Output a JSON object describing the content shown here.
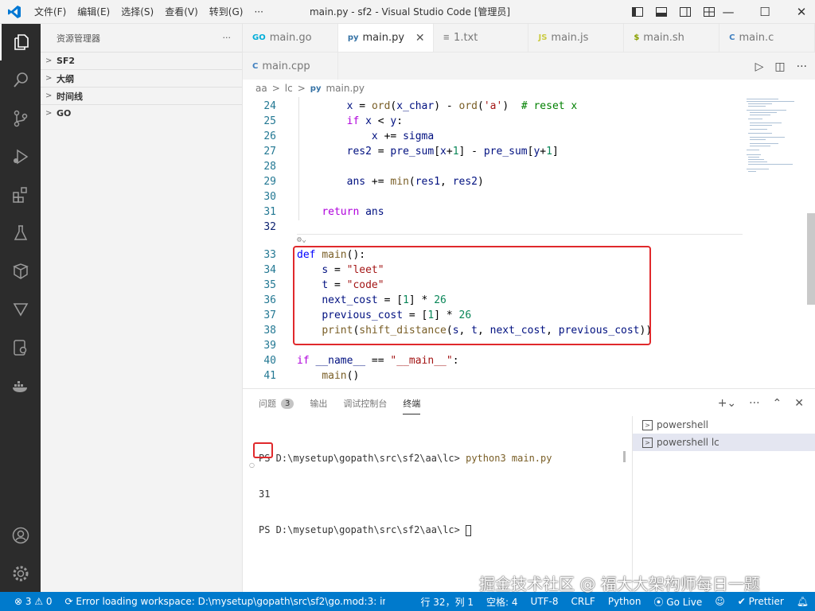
{
  "window": {
    "title": "main.py - sf2 - Visual Studio Code [管理员]",
    "menu": [
      "文件(F)",
      "编辑(E)",
      "选择(S)",
      "查看(V)",
      "转到(G)",
      "···"
    ],
    "controls": {
      "minimize": "—",
      "maximize": "☐",
      "close": "✕"
    }
  },
  "sidebar": {
    "title": "资源管理器",
    "more": "···",
    "sections": [
      "SF2",
      "大纲",
      "时间线",
      "GO"
    ]
  },
  "tabs": [
    {
      "label": "main.go",
      "icon": "GO"
    },
    {
      "label": "main.py",
      "icon": "py",
      "active": true
    },
    {
      "label": "1.txt",
      "icon": "≡"
    },
    {
      "label": "main.js",
      "icon": "JS"
    },
    {
      "label": "main.sh",
      "icon": "$"
    },
    {
      "label": "main.c",
      "icon": "C"
    },
    {
      "label": "main.cpp",
      "icon": "C"
    }
  ],
  "breadcrumb": [
    "aa",
    ">",
    "lc",
    ">",
    "main.py"
  ],
  "editor": {
    "lines": [
      {
        "n": "24",
        "code": "        x = ord(x_char) - ord('a')  # reset x"
      },
      {
        "n": "25",
        "code": "        if x < y:"
      },
      {
        "n": "26",
        "code": "            x += sigma"
      },
      {
        "n": "27",
        "code": "        res2 = pre_sum[x+1] - pre_sum[y+1]"
      },
      {
        "n": "28",
        "code": ""
      },
      {
        "n": "29",
        "code": "        ans += min(res1, res2)"
      },
      {
        "n": "30",
        "code": ""
      },
      {
        "n": "31",
        "code": "    return ans"
      },
      {
        "n": "32",
        "code": ""
      },
      {
        "n": "33",
        "code": "def main():"
      },
      {
        "n": "34",
        "code": "    s = \"leet\""
      },
      {
        "n": "35",
        "code": "    t = \"code\""
      },
      {
        "n": "36",
        "code": "    next_cost = [1] * 26"
      },
      {
        "n": "37",
        "code": "    previous_cost = [1] * 26"
      },
      {
        "n": "38",
        "code": "    print(shift_distance(s, t, next_cost, previous_cost))"
      },
      {
        "n": "39",
        "code": ""
      },
      {
        "n": "40",
        "code": "if __name__ == \"__main__\":"
      },
      {
        "n": "41",
        "code": "    main()"
      }
    ]
  },
  "panel": {
    "tabs": [
      "问题",
      "输出",
      "调试控制台",
      "终端"
    ],
    "problems_count": "3",
    "active_tab": "终端",
    "terminal_lines": [
      {
        "prompt": "PS D:\\mysetup\\gopath\\src\\sf2\\aa\\lc> ",
        "cmd": "python3 main.py"
      },
      {
        "prompt": "31",
        "cmd": ""
      },
      {
        "prompt": "PS D:\\mysetup\\gopath\\src\\sf2\\aa\\lc> ",
        "cmd": ""
      }
    ],
    "terminals": [
      "powershell",
      "powershell  lc"
    ]
  },
  "statusbar": {
    "errors": "3",
    "warnings": "0",
    "message": "Error loading workspace: D:\\mysetup\\gopath\\src\\sf2\\go.mod:3: invalid g",
    "position": "行 32，列 1",
    "spaces": "空格: 4",
    "encoding": "UTF-8",
    "eol": "CRLF",
    "language": "Python",
    "golive": "Go Live",
    "prettier": "Prettier"
  },
  "watermark": "掘金技术社区 @ 福大大架构师每日一题",
  "colors": {
    "activity_bar": "#2c2c2c",
    "status_bar": "#007acc",
    "highlight": "#e0292c"
  }
}
